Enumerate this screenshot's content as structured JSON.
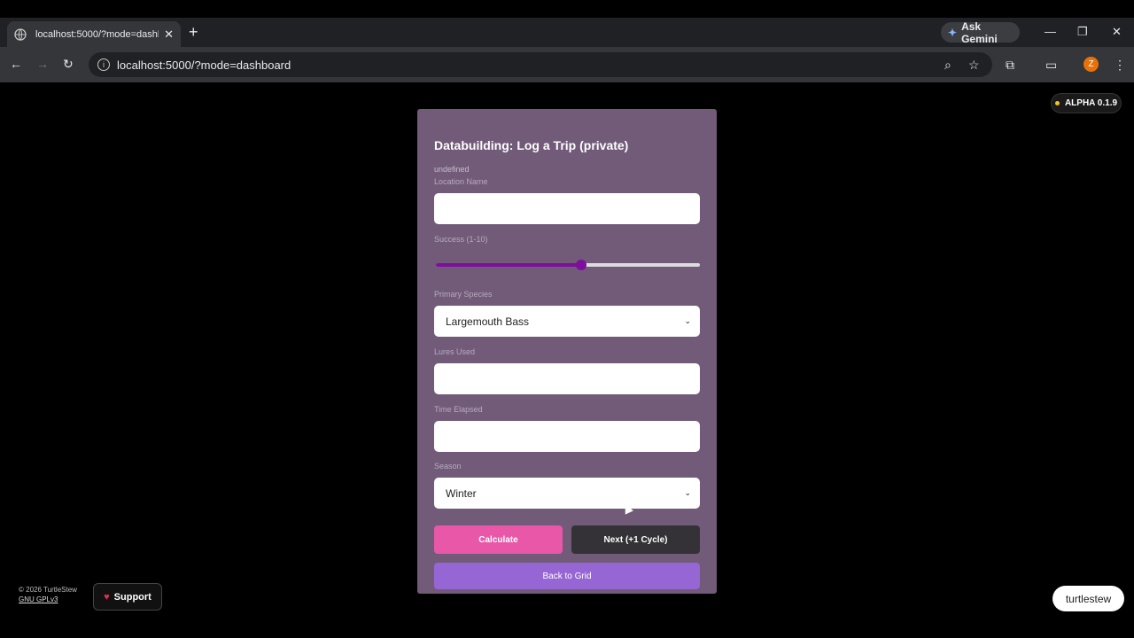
{
  "browser": {
    "tab_title": "localhost:5000/?mode=dashbo",
    "url": "localhost:5000/?mode=dashboard",
    "gemini_label": "Ask Gemini",
    "profile_initial": "Z"
  },
  "badge": {
    "version": "ALPHA 0.1.9"
  },
  "form": {
    "title": "Databuilding: Log a Trip (private)",
    "undefined_text": "undefined",
    "location_label": "Location Name",
    "location_value": "",
    "success_label": "Success (1-10)",
    "success_value": 0.55,
    "species_label": "Primary Species",
    "species_value": "Largemouth Bass",
    "lures_label": "Lures Used",
    "lures_value": "",
    "time_label": "Time Elapsed",
    "time_value": "",
    "season_label": "Season",
    "season_value": "Winter",
    "calculate_label": "Calculate",
    "next_label": "Next (+1 Cycle)",
    "back_label": "Back to Grid"
  },
  "footer": {
    "copyright": "© 2026 TurtleStew",
    "license": "GNU GPLv3",
    "support_label": "Support",
    "brand": "turtlestew"
  },
  "colors": {
    "card": "#715b79",
    "slider": "#7d0f9c",
    "calculate": "#e957a9",
    "next": "#343236",
    "back": "#9666d4"
  }
}
